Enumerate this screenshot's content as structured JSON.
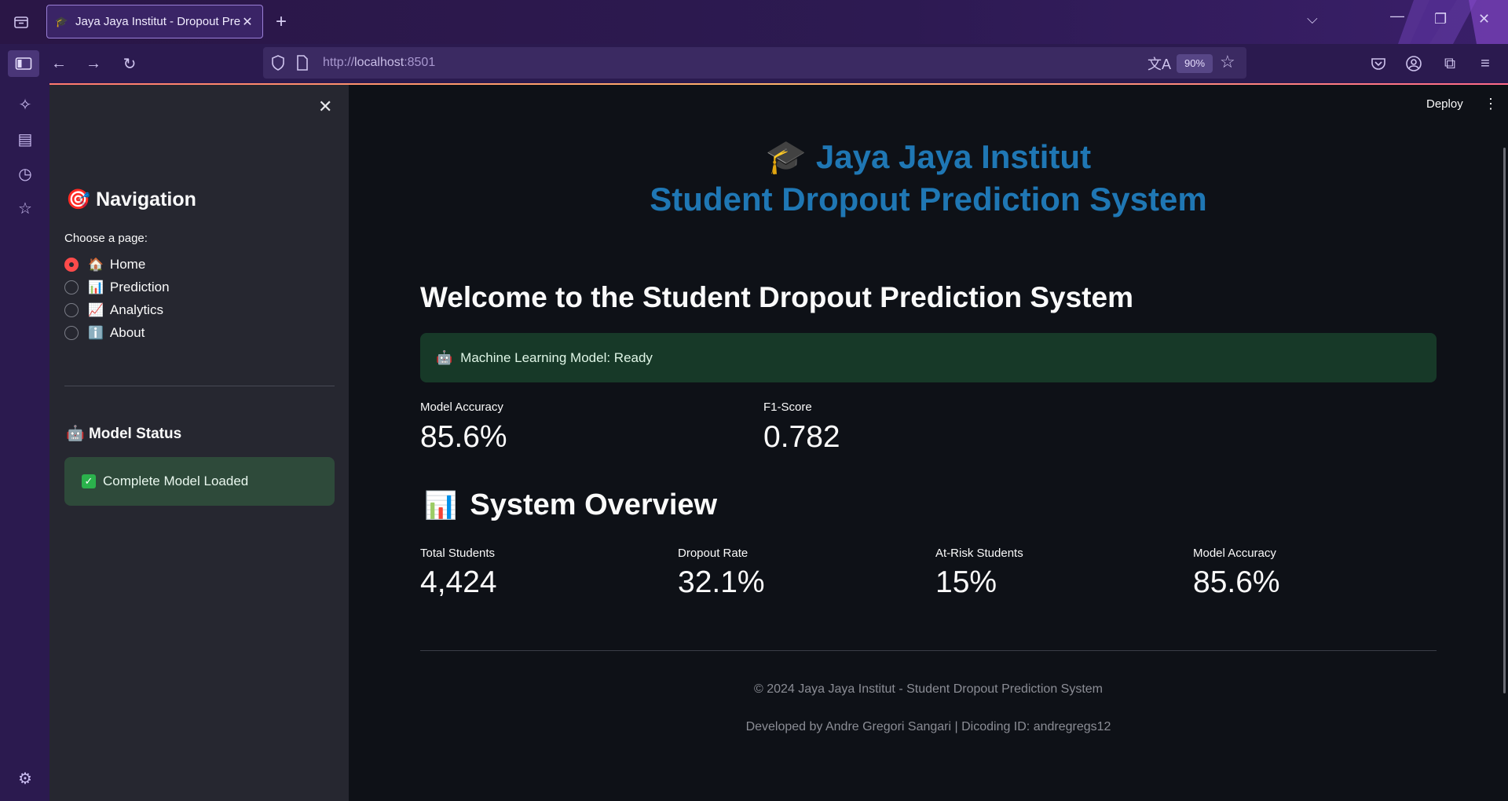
{
  "browser": {
    "tab_title": "Jaya Jaya Institut - Dropout Pre",
    "url_prefix": "http://",
    "url_host": "localhost",
    "url_port": ":8501",
    "zoom": "90%",
    "icons": [
      "tab-list-icon",
      "sidebar-toggle-icon",
      "back-icon",
      "forward-icon",
      "reload-icon",
      "shield-icon",
      "page-icon",
      "translate-icon",
      "star-icon",
      "pocket-icon",
      "account-icon",
      "extensions-icon",
      "menu-icon"
    ]
  },
  "sidebar": {
    "title": "Navigation",
    "title_emoji": "🎯",
    "choose_label": "Choose a page:",
    "pages": [
      {
        "emoji": "🏠",
        "label": "Home",
        "selected": true
      },
      {
        "emoji": "📊",
        "label": "Prediction",
        "selected": false
      },
      {
        "emoji": "📈",
        "label": "Analytics",
        "selected": false
      },
      {
        "emoji": "ℹ️",
        "label": "About",
        "selected": false
      }
    ],
    "model_status_title": "Model Status",
    "model_status_emoji": "🤖",
    "model_status_text": "Complete Model Loaded"
  },
  "header": {
    "deploy_label": "Deploy",
    "title_emoji": "🎓",
    "title_line1": "Jaya Jaya Institut",
    "title_line2": "Student Dropout Prediction System"
  },
  "main": {
    "welcome": "Welcome to the Student Dropout Prediction System",
    "ready_emoji": "🤖",
    "ready_text": "Machine Learning Model: Ready",
    "metrics_top": [
      {
        "label": "Model Accuracy",
        "value": "85.6%"
      },
      {
        "label": "F1-Score",
        "value": "0.782"
      }
    ],
    "overview_emoji": "📊",
    "overview_title": "System Overview",
    "overview_metrics": [
      {
        "label": "Total Students",
        "value": "4,424"
      },
      {
        "label": "Dropout Rate",
        "value": "32.1%"
      },
      {
        "label": "At-Risk Students",
        "value": "15%"
      },
      {
        "label": "Model Accuracy",
        "value": "85.6%"
      }
    ],
    "footer_line1": "© 2024 Jaya Jaya Institut - Student Dropout Prediction System",
    "footer_line2": "Developed by Andre Gregori Sangari | Dicoding ID: andregregs12"
  },
  "colors": {
    "accent_title": "#1f77b4",
    "radio_selected": "#ff4b4b",
    "success_bg": "#173928",
    "main_bg": "#0e1117",
    "sidebar_bg": "#262730"
  }
}
